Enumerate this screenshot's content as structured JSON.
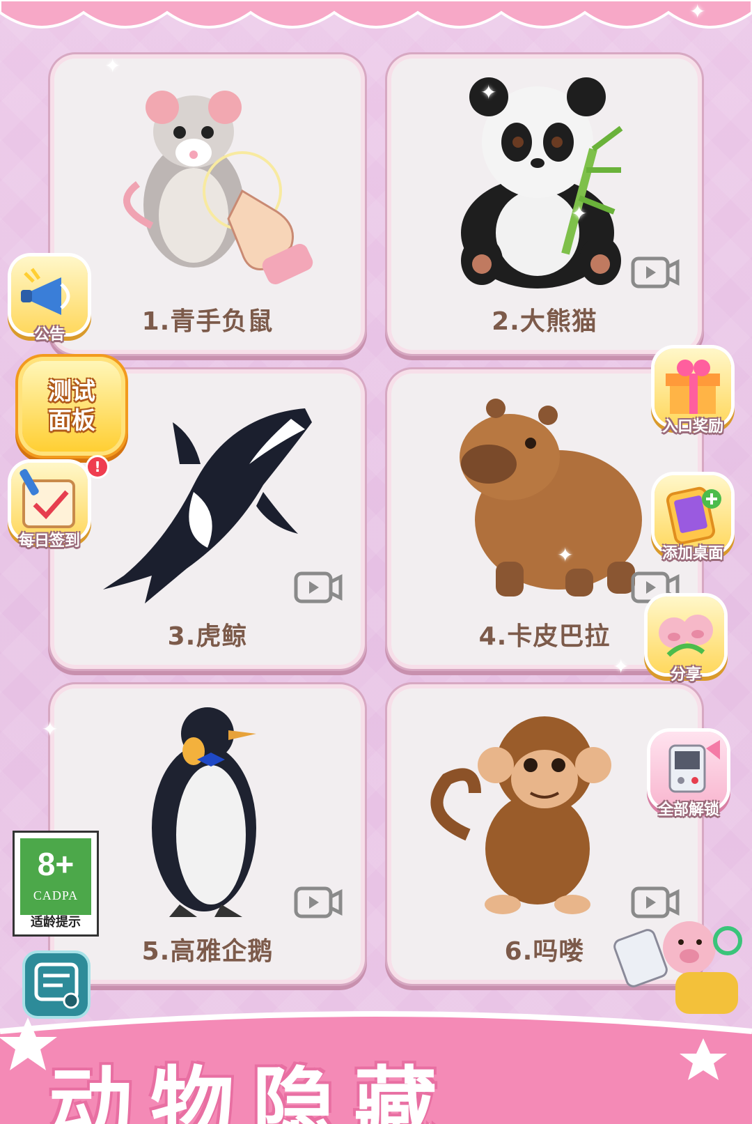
{
  "levels": [
    {
      "label": "1.青手负鼠",
      "locked_video": false
    },
    {
      "label": "2.大熊猫",
      "locked_video": true
    },
    {
      "label": "3.虎鲸",
      "locked_video": true
    },
    {
      "label": "4.卡皮巴拉",
      "locked_video": true
    },
    {
      "label": "5.高雅企鹅",
      "locked_video": true
    },
    {
      "label": "6.吗喽",
      "locked_video": true
    }
  ],
  "left_widgets": {
    "announcement": "公告",
    "test_panel": "测试面板",
    "daily_checkin": "每日签到"
  },
  "right_widgets": {
    "entry_reward": "入口奖励",
    "add_desktop": "添加桌面",
    "share": "分享",
    "unlock_all": "全部解锁"
  },
  "age_rating": {
    "age": "8+",
    "org": "CADPA",
    "tip": "适龄提示"
  },
  "banner": {
    "text": "动物隐藏"
  },
  "colors": {
    "label_text": "#7c5a4a",
    "card_bg": "#f2eef0",
    "page_bg": "#e9c6e5"
  }
}
